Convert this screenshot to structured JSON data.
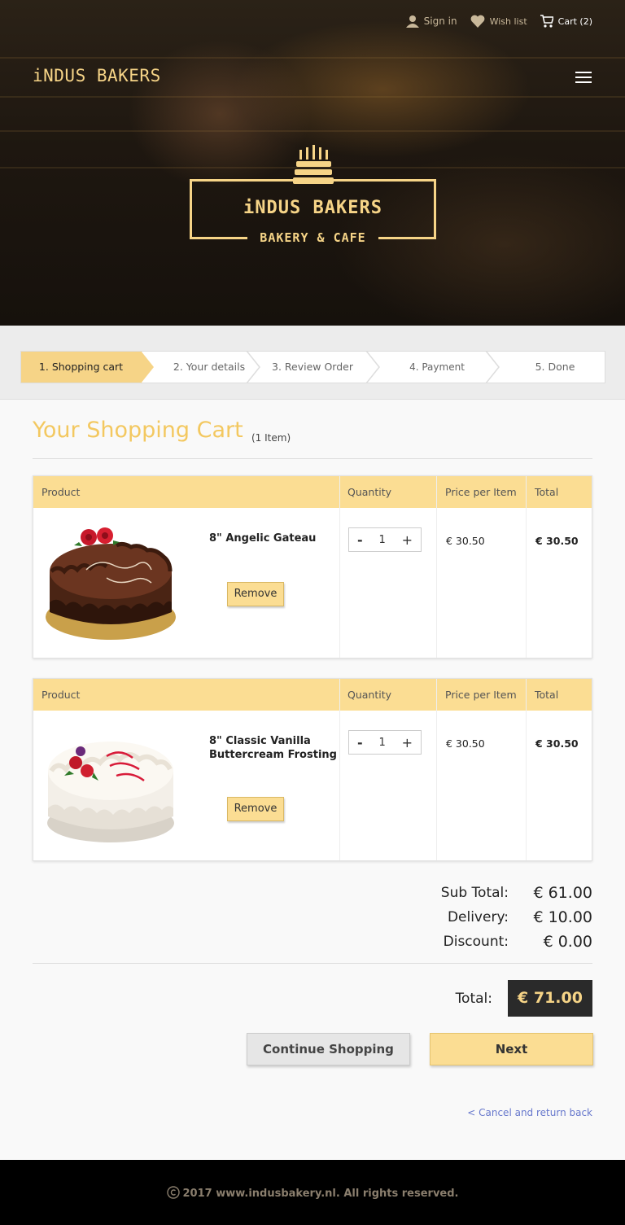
{
  "header": {
    "sign_in": "Sign in",
    "wish_list": "Wish list",
    "cart": "Cart (2)",
    "brand": "iNDUS BAKERS"
  },
  "hero": {
    "logo_title": "iNDUS BAKERS",
    "logo_subtitle": "BAKERY & CAFE"
  },
  "steps": [
    {
      "label": "1. Shopping cart",
      "active": true
    },
    {
      "label": "2. Your details",
      "active": false
    },
    {
      "label": "3. Review Order",
      "active": false
    },
    {
      "label": "4. Payment",
      "active": false
    },
    {
      "label": "5. Done",
      "active": false
    }
  ],
  "cart": {
    "title": "Your Shopping Cart",
    "count": "(1 Item)",
    "columns": [
      "Product",
      "Quantity",
      "Price per Item",
      "Total"
    ],
    "items": [
      {
        "name": "8\" Angelic Gateau",
        "quantity": "1",
        "price": "€ 30.50",
        "total": "€ 30.50",
        "remove": "Remove"
      },
      {
        "name": "8\" Classic Vanilla Buttercream Frosting",
        "quantity": "1",
        "price": "€ 30.50",
        "total": "€ 30.50",
        "remove": "Remove"
      }
    ]
  },
  "summary": {
    "subtotal_label": "Sub Total:",
    "subtotal": "€ 61.00",
    "delivery_label": "Delivery:",
    "delivery": "€ 10.00",
    "discount_label": "Discount:",
    "discount": "€ 0.00",
    "total_label": "Total:",
    "total": "€ 71.00"
  },
  "actions": {
    "continue": "Continue Shopping",
    "next": "Next",
    "cancel": "< Cancel and return back"
  },
  "footer": {
    "copyright": "2017 www.indusbakery.nl. All rights reserved."
  },
  "colors": {
    "accent": "#f6d487",
    "header_row": "#fbdd93",
    "title": "#f3c860",
    "dark": "#2a2a2a"
  }
}
